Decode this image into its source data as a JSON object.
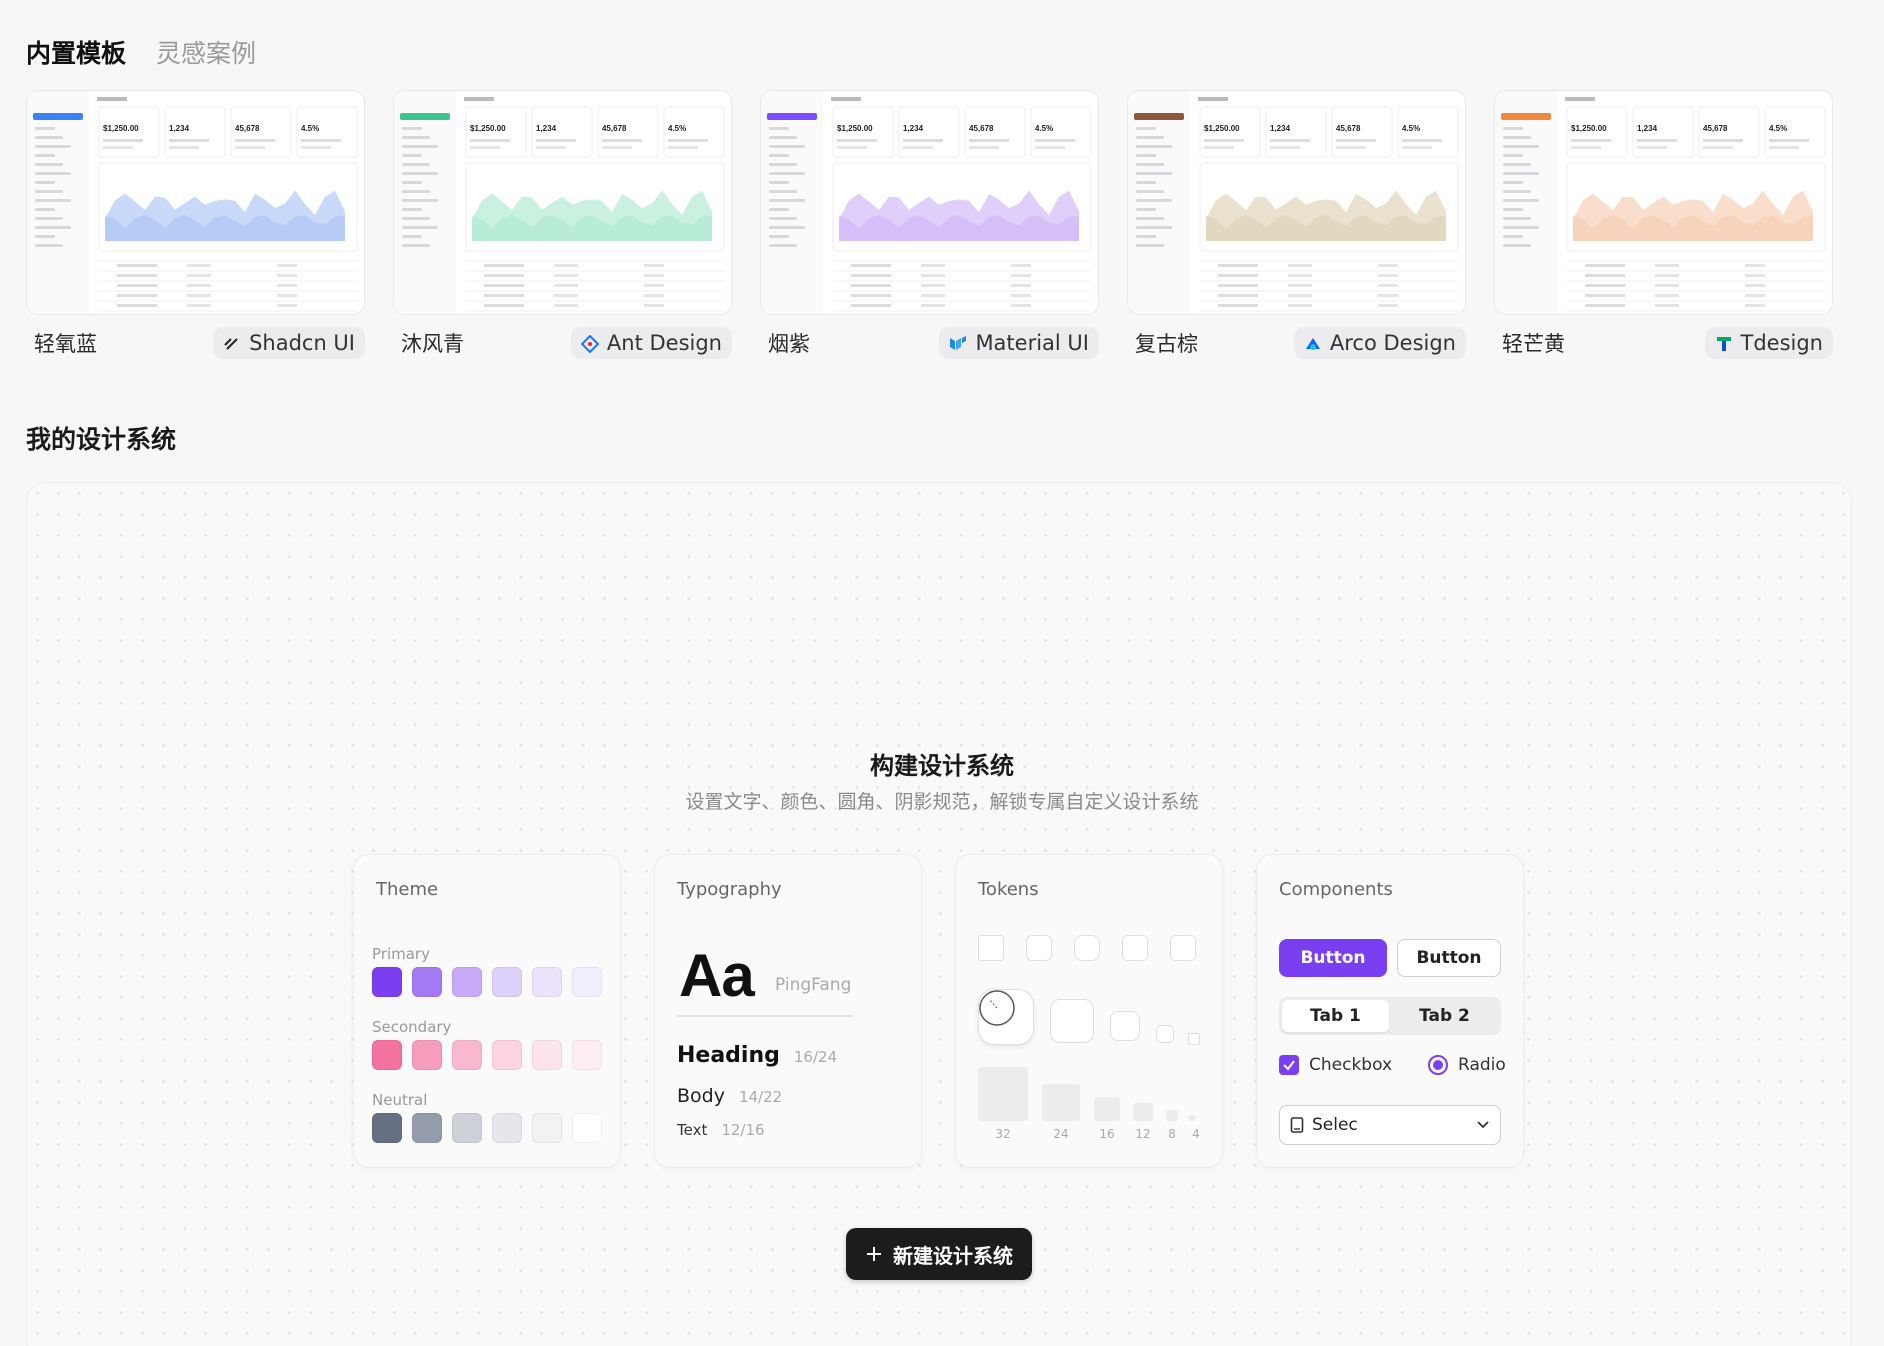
{
  "tabs": [
    "内置模板",
    "灵感案例"
  ],
  "templates": [
    {
      "name": "轻氧蓝",
      "brand": "Shadcn UI",
      "accent": "#3b82f6",
      "wave": "#9bb9f4",
      "logo_icon": "shadcn-slash-icon"
    },
    {
      "name": "沐风青",
      "brand": "Ant Design",
      "accent": "#3cc48f",
      "wave": "#9ee6c6",
      "logo_icon": "ant-design-diamond-icon"
    },
    {
      "name": "烟紫",
      "brand": "Material UI",
      "accent": "#7c4dff",
      "wave": "#c7a7f5",
      "logo_icon": "material-ui-logo-icon"
    },
    {
      "name": "复古棕",
      "brand": "Arco Design",
      "accent": "#8a5a3b",
      "wave": "#d8c8a8",
      "logo_icon": "arco-design-logo-icon"
    },
    {
      "name": "轻芒黄",
      "brand": "Tdesign",
      "accent": "#f0883e",
      "wave": "#f6c3a3",
      "logo_icon": "tdesign-t-icon"
    }
  ],
  "thumbnail_kpis": [
    "$1,250.00",
    "1,234",
    "45,678",
    "4.5%"
  ],
  "section_title": "我的设计系统",
  "build": {
    "title": "构建设计系统",
    "subtitle": "设置文字、颜色、圆角、阴影规范，解锁专属自定义设计系统"
  },
  "theme_card": {
    "title": "Theme",
    "primary_label": "Primary",
    "secondary_label": "Secondary",
    "neutral_label": "Neutral",
    "primary": [
      "#7b3ff2",
      "#a57bf5",
      "#c7aaf8",
      "#ddd0fb",
      "#ebe3fc",
      "#f3eefd"
    ],
    "secondary": [
      "#f2739f",
      "#f69cbd",
      "#f8b9d0",
      "#fbd3e1",
      "#fde4ec",
      "#feeef3"
    ],
    "neutral": [
      "#676f82",
      "#959cab",
      "#cdd1d8",
      "#e5e7eb",
      "#f1f2f4",
      "#ffffff"
    ]
  },
  "typography_card": {
    "title": "Typography",
    "sample": "Aa",
    "font": "PingFang",
    "heading": "Heading",
    "heading_size": "16/24",
    "body": "Body",
    "body_size": "14/22",
    "text": "Text",
    "text_size": "12/16"
  },
  "tokens_card": {
    "title": "Tokens",
    "scale": [
      "32",
      "24",
      "16",
      "12",
      "8",
      "4"
    ]
  },
  "components_card": {
    "title": "Components",
    "primary_button": "Button",
    "secondary_button": "Button",
    "tab1": "Tab 1",
    "tab2": "Tab 2",
    "checkbox": "Checkbox",
    "radio": "Radio",
    "select": "Selec"
  },
  "new_button": "新建设计系统",
  "colors": {
    "brand_purple": "#7b3ff2",
    "dark_button": "#1c1c1c"
  }
}
